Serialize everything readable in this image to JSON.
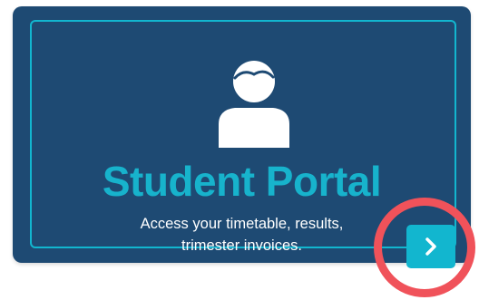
{
  "card": {
    "title": "Student Portal",
    "description_line1": "Access your timetable, results,",
    "description_line2": "trimester invoices.",
    "icon": "user-avatar-icon",
    "button_icon": "chevron-right-icon"
  },
  "colors": {
    "card_background": "#1e4a73",
    "accent": "#17b3cc",
    "highlight_ring": "#f0525a"
  }
}
